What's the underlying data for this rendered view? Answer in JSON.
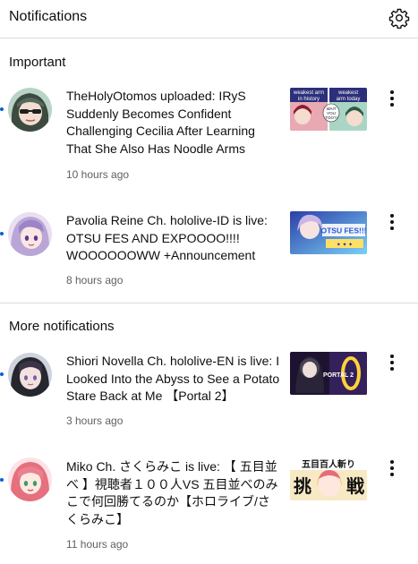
{
  "header": {
    "title": "Notifications",
    "settings_icon": "gear-icon"
  },
  "sections": {
    "important": {
      "title": "Important"
    },
    "more": {
      "title": "More notifications"
    }
  },
  "notifications": [
    {
      "text": "TheHolyOtomos uploaded: IRyS Suddenly Becomes Confident Challenging Cecilia After Learning That She Also Has Noodle Arms",
      "time": "10 hours ago",
      "unread": true,
      "thumb_text_1": "weakest arm in history",
      "thumb_text_2": "weakest arm today",
      "thumb_bubble": "WAIT YOU TOO?!"
    },
    {
      "text": "Pavolia Reine Ch. hololive-ID is live: OTSU FES AND EXPOOOO!!!! WOOOOOOWW +Announcement",
      "time": "8 hours ago",
      "unread": true,
      "thumb_text_1": "OTSU FES!!!"
    },
    {
      "text": "Shiori Novella Ch. hololive-EN is live: I Looked Into the Abyss to See a Potato Stare Back at Me 【Portal 2】",
      "time": "3 hours ago",
      "unread": true,
      "thumb_text_1": "PORTAL 2"
    },
    {
      "text": "Miko Ch. さくらみこ is live: 【 五目並べ 】視聴者１００人VS 五目並べのみこで何回勝てるのか【ホロライブ/さくらみこ】",
      "time": "11 hours ago",
      "unread": true,
      "thumb_text_1": "五目百人斬り",
      "thumb_text_2": "挑",
      "thumb_text_3": "戦"
    }
  ],
  "colors": {
    "unread_dot": "#065fd4",
    "text_primary": "#0f0f0f",
    "text_secondary": "#606060",
    "divider": "#dcdcdc"
  }
}
